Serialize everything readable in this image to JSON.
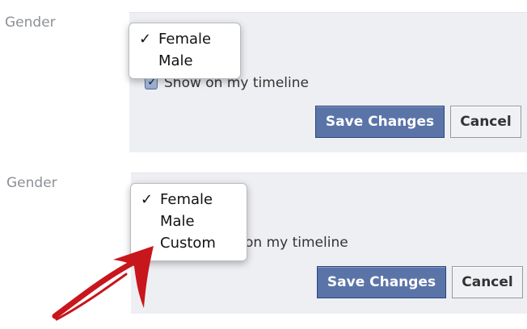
{
  "top": {
    "field_label": "Gender",
    "dropdown": {
      "options": [
        {
          "label": "Female",
          "checked": true
        },
        {
          "label": "Male",
          "checked": false
        }
      ]
    },
    "timeline_label": "Show on my timeline",
    "timeline_checked": true,
    "save_label": "Save Changes",
    "cancel_label": "Cancel"
  },
  "bottom": {
    "field_label": "Gender",
    "dropdown": {
      "options": [
        {
          "label": "Female",
          "checked": true
        },
        {
          "label": "Male",
          "checked": false
        },
        {
          "label": "Custom",
          "checked": false
        }
      ]
    },
    "timeline_label": "on my timeline",
    "save_label": "Save Changes",
    "cancel_label": "Cancel"
  },
  "check_glyph": "✓",
  "colors": {
    "panel_bg": "#eeeff2",
    "primary_button": "#5b74a8",
    "arrow": "#c8161d",
    "label_gray": "#8c9097"
  }
}
